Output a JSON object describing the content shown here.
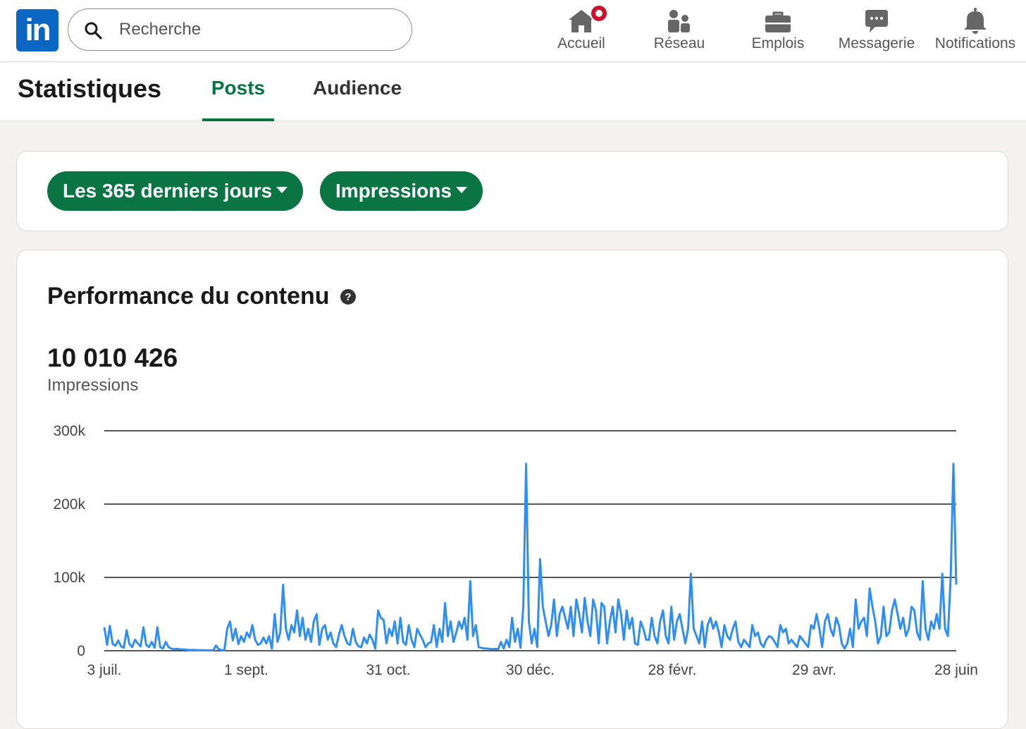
{
  "nav": {
    "logo_text": "in",
    "search": {
      "placeholder": "Recherche"
    },
    "items": [
      {
        "label": "Accueil",
        "icon": "home-icon",
        "has_badge": true
      },
      {
        "label": "Réseau",
        "icon": "people-icon"
      },
      {
        "label": "Emplois",
        "icon": "briefcase-icon"
      },
      {
        "label": "Messagerie",
        "icon": "chat-icon"
      },
      {
        "label": "Notifications",
        "icon": "bell-icon"
      }
    ]
  },
  "header": {
    "title": "Statistiques",
    "tabs": [
      {
        "label": "Posts",
        "active": true
      },
      {
        "label": "Audience",
        "active": false
      }
    ]
  },
  "filters": {
    "period": "Les 365 derniers jours",
    "metric": "Impressions"
  },
  "performance": {
    "title": "Performance du contenu",
    "total": "10 010 426",
    "metric_label": "Impressions"
  },
  "colors": {
    "brand_blue": "#0a66c2",
    "accent_green": "#057642",
    "line_blue": "#2f8ef0",
    "badge_red": "#cb112d"
  },
  "chart_data": {
    "type": "line",
    "title": "",
    "xlabel": "",
    "ylabel": "",
    "x_range": [
      "3 juil.",
      "28 juin"
    ],
    "ylim": [
      0,
      300000
    ],
    "y_ticks": [
      {
        "value": 0,
        "label": "0"
      },
      {
        "value": 100000,
        "label": "100k"
      },
      {
        "value": 200000,
        "label": "200k"
      },
      {
        "value": 300000,
        "label": "300k"
      }
    ],
    "x_ticks": [
      "3 juil.",
      "1 sept.",
      "31 oct.",
      "30 déc.",
      "28 févr.",
      "29 avr.",
      "28 juin"
    ],
    "grid": true,
    "legend": "none",
    "series": [
      {
        "values": [
          32000,
          8000,
          34000,
          9000,
          7000,
          14000,
          6000,
          4000,
          28000,
          9000,
          5000,
          15000,
          10000,
          6000,
          32000,
          8000,
          5000,
          12000,
          4000,
          32000,
          5000,
          3000,
          12000,
          5000,
          3000,
          2000,
          2500,
          2000,
          1800,
          1500,
          1200,
          1000,
          1200,
          1000,
          800,
          900,
          700,
          600,
          500,
          800,
          7000,
          2000,
          1000,
          500,
          30000,
          40000,
          14000,
          30000,
          9000,
          20000,
          12000,
          25000,
          18000,
          35000,
          15000,
          8000,
          10000,
          18000,
          10000,
          20000,
          3000,
          50000,
          12000,
          25000,
          90000,
          30000,
          15000,
          35000,
          25000,
          55000,
          20000,
          45000,
          15000,
          30000,
          12000,
          40000,
          50000,
          8000,
          30000,
          35000,
          15000,
          25000,
          10000,
          5000,
          22000,
          35000,
          20000,
          10000,
          8000,
          30000,
          12000,
          6000,
          5000,
          18000,
          10000,
          22000,
          15000,
          3000,
          55000,
          45000,
          42000,
          10000,
          30000,
          20000,
          40000,
          10000,
          45000,
          12000,
          8000,
          35000,
          15000,
          5000,
          30000,
          22000,
          15000,
          5000,
          10000,
          12000,
          35000,
          5000,
          30000,
          12000,
          65000,
          20000,
          40000,
          12000,
          25000,
          40000,
          30000,
          45000,
          15000,
          95000,
          20000,
          35000,
          5000,
          4000,
          3000,
          3000,
          2500,
          2000,
          2500,
          2000,
          12000,
          3000,
          15000,
          5000,
          45000,
          12000,
          30000,
          4000,
          60000,
          255000,
          40000,
          10000,
          30000,
          5000,
          125000,
          60000,
          40000,
          20000,
          35000,
          70000,
          20000,
          50000,
          60000,
          45000,
          30000,
          60000,
          20000,
          70000,
          50000,
          25000,
          72000,
          40000,
          20000,
          70000,
          55000,
          10000,
          65000,
          60000,
          10000,
          40000,
          60000,
          25000,
          70000,
          50000,
          15000,
          55000,
          30000,
          45000,
          10000,
          8000,
          40000,
          30000,
          15000,
          15000,
          45000,
          20000,
          10000,
          40000,
          55000,
          20000,
          10000,
          60000,
          15000,
          40000,
          50000,
          30000,
          10000,
          30000,
          105000,
          30000,
          20000,
          10000,
          40000,
          5000,
          35000,
          45000,
          30000,
          40000,
          25000,
          5000,
          35000,
          20000,
          15000,
          30000,
          40000,
          12000,
          5000,
          15000,
          10000,
          5000,
          35000,
          20000,
          25000,
          10000,
          5000,
          15000,
          20000,
          18000,
          12000,
          5000,
          35000,
          25000,
          30000,
          10000,
          15000,
          10000,
          5000,
          20000,
          15000,
          10000,
          5000,
          35000,
          30000,
          50000,
          30000,
          5000,
          40000,
          50000,
          30000,
          20000,
          45000,
          35000,
          10000,
          3000,
          10000,
          30000,
          5000,
          70000,
          30000,
          40000,
          45000,
          20000,
          85000,
          60000,
          40000,
          10000,
          20000,
          60000,
          20000,
          25000,
          55000,
          70000,
          50000,
          30000,
          45000,
          20000,
          30000,
          60000,
          55000,
          25000,
          15000,
          95000,
          30000,
          15000,
          40000,
          30000,
          50000,
          30000,
          105000,
          30000,
          20000,
          100000,
          255000,
          90000
        ]
      }
    ]
  }
}
